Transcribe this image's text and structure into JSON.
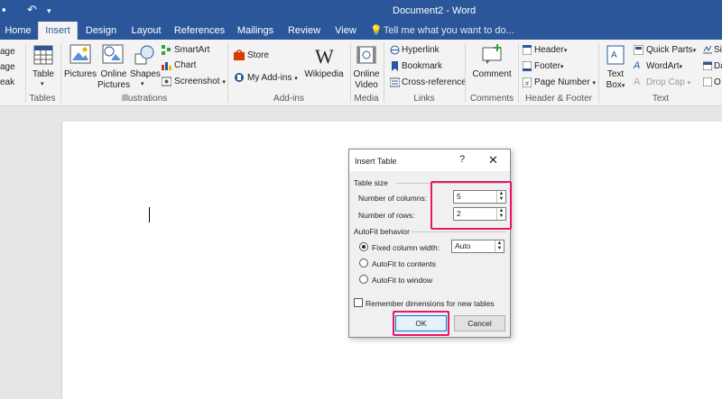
{
  "titlebar": {
    "document_title": "Document2 - Word"
  },
  "tabs": [
    {
      "label": "Home"
    },
    {
      "label": "Insert"
    },
    {
      "label": "Design"
    },
    {
      "label": "Layout"
    },
    {
      "label": "References"
    },
    {
      "label": "Mailings"
    },
    {
      "label": "Review"
    },
    {
      "label": "View"
    }
  ],
  "tell_me": "Tell me what you want to do...",
  "ribbon": {
    "cutoff": {
      "l1": "age",
      "l2": "age",
      "l3": "eak"
    },
    "tables": {
      "table": "Table",
      "group": "Tables"
    },
    "illustrations": {
      "pictures": "Pictures",
      "online_pictures_1": "Online",
      "online_pictures_2": "Pictures",
      "shapes": "Shapes",
      "smartart": "SmartArt",
      "chart": "Chart",
      "screenshot": "Screenshot",
      "group": "Illustrations"
    },
    "addins": {
      "store": "Store",
      "my_addins": "My Add-ins",
      "wikipedia": "Wikipedia",
      "group": "Add-ins"
    },
    "media": {
      "online_1": "Online",
      "online_2": "Video",
      "group": "Media"
    },
    "links": {
      "hyperlink": "Hyperlink",
      "bookmark": "Bookmark",
      "cross_reference": "Cross-reference",
      "group": "Links"
    },
    "comments": {
      "comment": "Comment",
      "group": "Comments"
    },
    "header_footer": {
      "header": "Header",
      "footer": "Footer",
      "page_number": "Page Number",
      "group": "Header & Footer"
    },
    "text": {
      "text_box_1": "Text",
      "text_box_2": "Box",
      "quick_parts": "Quick Parts",
      "wordart": "WordArt",
      "drop_cap": "Drop Cap",
      "cut1": "Si",
      "cut2": "Da",
      "cut3": "O",
      "group": "Text"
    }
  },
  "dialog": {
    "title": "Insert Table",
    "help": "?",
    "close": "✕",
    "table_size": "Table size",
    "columns_label": "Number of columns:",
    "columns_value": "5",
    "rows_label": "Number of rows:",
    "rows_value": "2",
    "autofit_behavior": "AutoFit behavior",
    "fixed_label": "Fixed column width:",
    "fixed_value": "Auto",
    "autofit_contents": "AutoFit to contents",
    "autofit_window": "AutoFit to window",
    "remember": "Remember dimensions for new tables",
    "ok": "OK",
    "cancel": "Cancel"
  },
  "colors": {
    "accent": "#2b579a",
    "highlight": "#e8156c"
  }
}
